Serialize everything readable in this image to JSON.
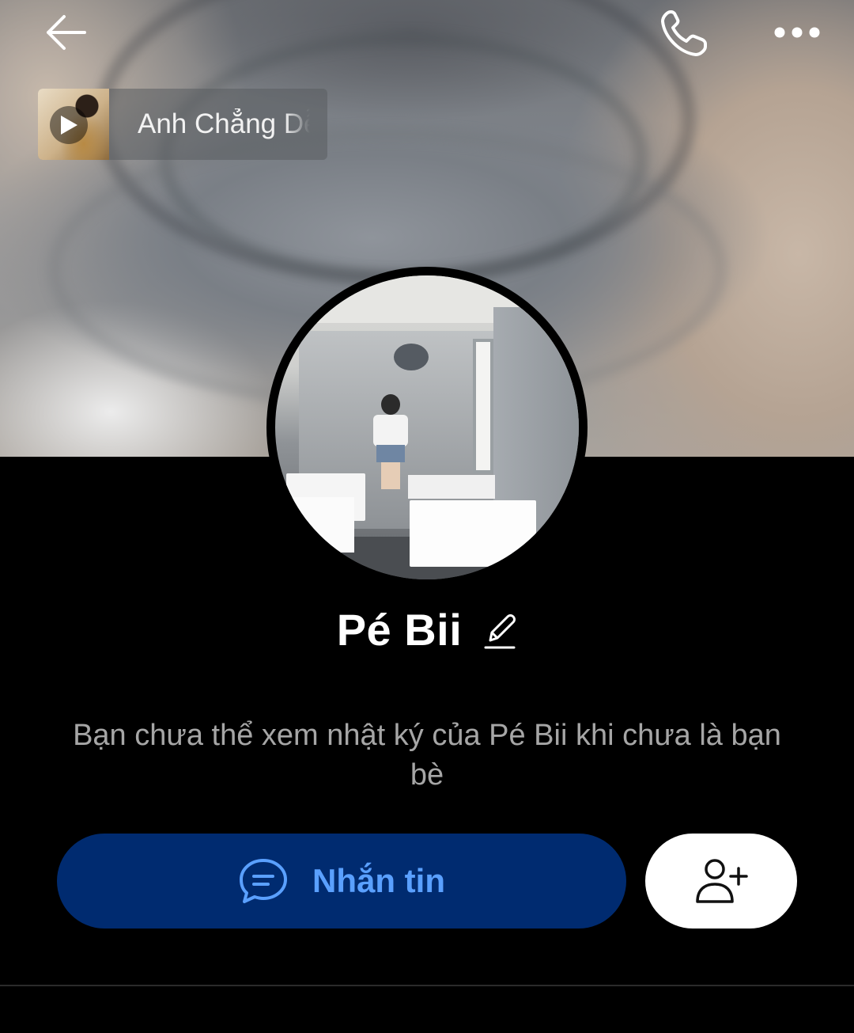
{
  "header": {
    "back_icon": "arrow-left-icon",
    "call_icon": "phone-icon",
    "more_icon": "more-horizontal-icon"
  },
  "music": {
    "title": "Anh Chẳng Dễ",
    "icon": "play-icon"
  },
  "profile": {
    "name": "Pé Bii",
    "edit_icon": "pencil-icon"
  },
  "notice": {
    "text": "Bạn chưa thể xem nhật ký của Pé Bii khi chưa là bạn bè"
  },
  "actions": {
    "message_label": "Nhắn tin",
    "message_icon": "chat-bubble-icon",
    "add_friend_icon": "add-friend-icon"
  },
  "colors": {
    "background": "#000000",
    "message_button_bg": "#002b70",
    "message_button_text": "#5aa0ff",
    "notice_text": "#a6a6a6"
  }
}
